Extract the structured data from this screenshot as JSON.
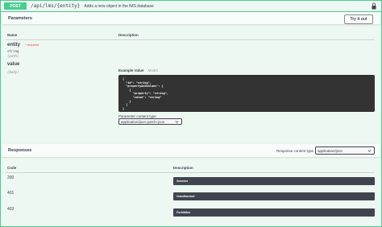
{
  "operation": {
    "method": "POST",
    "path": "/api/lms/{entity}",
    "summary": "Adds a new object in the lMS database"
  },
  "parameters_section": {
    "title": "Parameters",
    "try_it_out": "Try it out",
    "col_name": "Name",
    "col_description": "Description"
  },
  "params": [
    {
      "name": "entity",
      "required": "* required",
      "type": "string",
      "in": "(path)"
    },
    {
      "name": "value",
      "in": "(body)"
    }
  ],
  "body_example": {
    "tab_example": "Example Value",
    "tab_model": "Model",
    "code": "{\n  \"id\": \"string\",\n  \"propertyAndValues\": [\n    {\n      \"property\": \"string\",\n      \"value\": \"string\"\n    }\n  ]\n}"
  },
  "param_content_type": {
    "label": "Parameter content type",
    "value": "application/json-patch+json"
  },
  "responses_section": {
    "title": "Responses",
    "content_type_label": "Response content type",
    "content_type_value": "application/json",
    "col_code": "Code",
    "col_description": "Description"
  },
  "responses": [
    {
      "code": "200",
      "description": "Success"
    },
    {
      "code": "401",
      "description": "Unauthorized"
    },
    {
      "code": "403",
      "description": "Forbidden"
    }
  ],
  "colors": {
    "post_green": "#49cc90",
    "background": "#eef8f2",
    "code_bg": "#333333",
    "required_red": "#ff3a3a"
  }
}
